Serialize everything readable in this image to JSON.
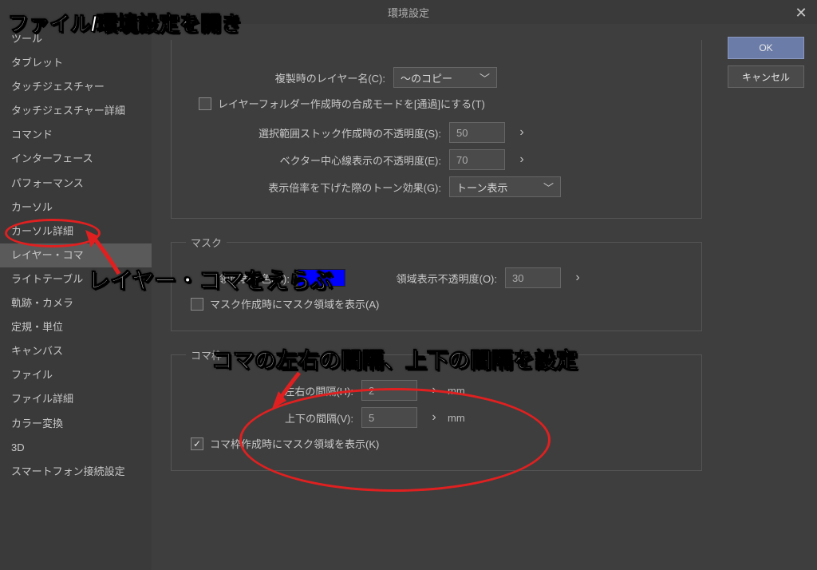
{
  "dialog": {
    "title": "環境設定",
    "ok": "OK",
    "cancel": "キャンセル"
  },
  "sidebar": {
    "items": [
      "ツール",
      "タブレット",
      "タッチジェスチャー",
      "タッチジェスチャー詳細",
      "コマンド",
      "インターフェース",
      "パフォーマンス",
      "カーソル",
      "カーソル詳細",
      "レイヤー・コマ",
      "ライトテーブル",
      "軌跡・カメラ",
      "定規・単位",
      "キャンバス",
      "ファイル",
      "ファイル詳細",
      "カラー変換",
      "3D",
      "スマートフォン接続設定"
    ],
    "selected_index": 9
  },
  "layer": {
    "duplicate_label": "複製時のレイヤー名(C):",
    "duplicate_value": "〜のコピー",
    "folder_passthrough": "レイヤーフォルダー作成時の合成モードを[通過]にする(T)",
    "sel_stock_opacity_label": "選択範囲ストック作成時の不透明度(S):",
    "sel_stock_opacity": "50",
    "vector_center_opacity_label": "ベクター中心線表示の不透明度(E):",
    "vector_center_opacity": "70",
    "tone_scaledown_label": "表示倍率を下げた際のトーン効果(G):",
    "tone_scaledown_value": "トーン表示"
  },
  "mask": {
    "legend": "マスク",
    "area_color_label": "領域表示色(M):",
    "area_opacity_label": "領域表示不透明度(O):",
    "area_opacity": "30",
    "show_mask_on_create": "マスク作成時にマスク領域を表示(A)"
  },
  "frame": {
    "legend": "コマ枠",
    "h_gap_label": "左右の間隔(H):",
    "h_gap": "2",
    "v_gap_label": "上下の間隔(V):",
    "v_gap": "5",
    "unit": "mm",
    "show_mask_on_create": "コマ枠作成時にマスク領域を表示(K)"
  },
  "annotations": {
    "a1": "ファイル/環境設定を開き",
    "a2": "レイヤー・コマをえらぶ",
    "a3": "コマの左右の間隔、上下の間隔を設定"
  }
}
